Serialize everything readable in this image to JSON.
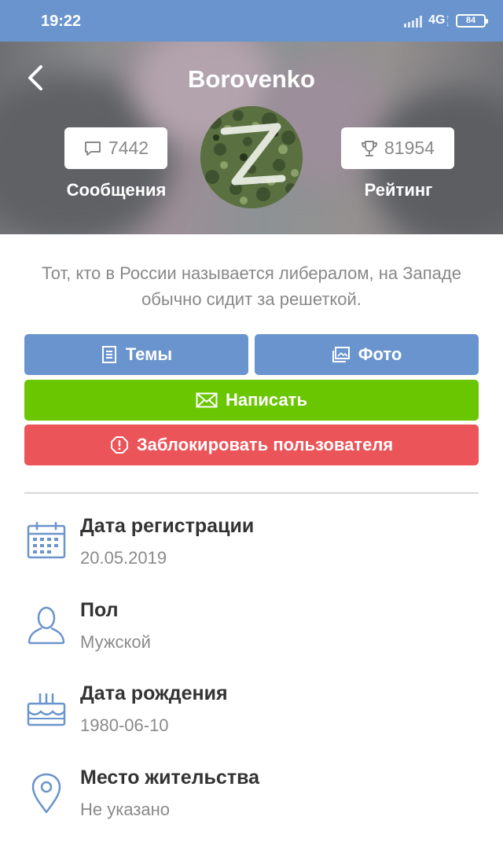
{
  "status_bar": {
    "time": "19:22",
    "network": "4G",
    "battery": "84"
  },
  "header": {
    "title": "Borovenko",
    "messages": {
      "count": "7442",
      "label": "Сообщения",
      "icon": "chat-bubble-icon"
    },
    "rating": {
      "count": "81954",
      "label": "Рейтинг",
      "icon": "trophy-icon"
    },
    "avatar": {
      "letter": "Z"
    }
  },
  "about": "Тот, кто в России называется либералом, на Западе обычно сидит за решеткой.",
  "actions": {
    "topics": "Темы",
    "photos": "Фото",
    "write": "Написать",
    "block": "Заблокировать пользователя"
  },
  "info": [
    {
      "label": "Дата регистрации",
      "value": "20.05.2019",
      "icon": "calendar-icon"
    },
    {
      "label": "Пол",
      "value": "Мужской",
      "icon": "user-icon"
    },
    {
      "label": "Дата рождения",
      "value": "1980-06-10",
      "icon": "birthday-cake-icon"
    },
    {
      "label": "Место жительства",
      "value": "Не указано",
      "icon": "location-pin-icon"
    }
  ],
  "colors": {
    "primary": "#6a94cd",
    "success": "#6ac600",
    "danger": "#eb5459",
    "icon": "#6a94cd"
  }
}
